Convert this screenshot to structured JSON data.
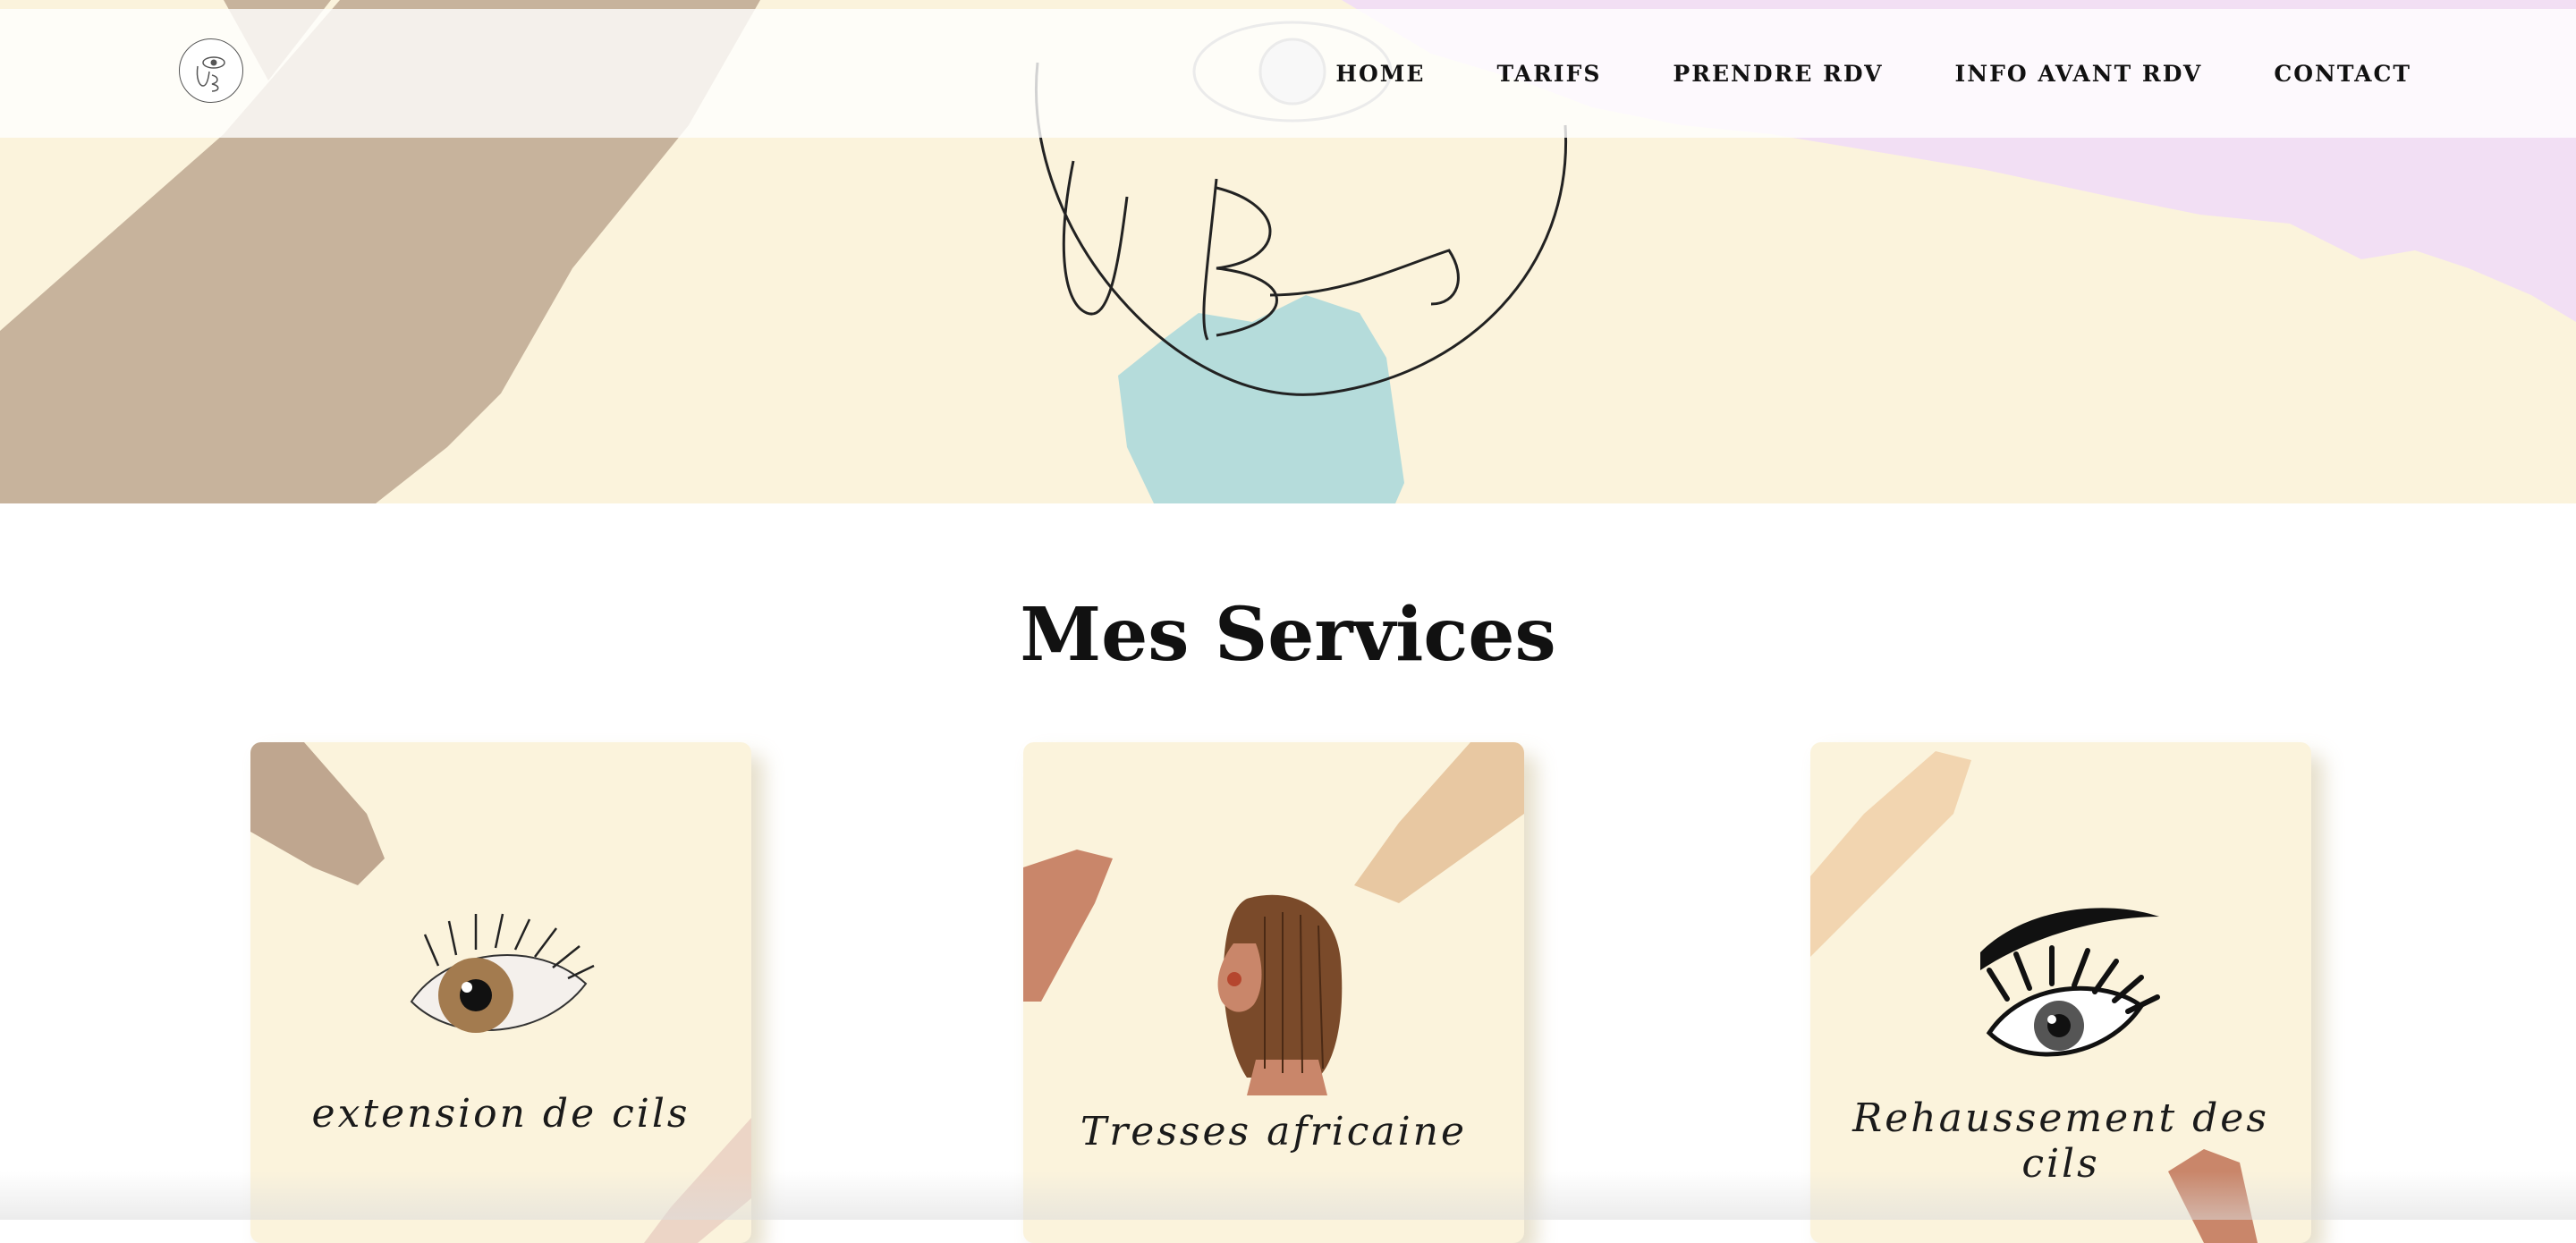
{
  "brand": {
    "logo_icon": "u-beauty-eye-logo",
    "colors": {
      "cream": "#fbf3dc",
      "taupe": "#c7b39c",
      "lilac": "#f2dff4",
      "aqua": "#b5dcdb",
      "peach": "#e8c8a2",
      "terracotta": "#c9866a"
    }
  },
  "nav": {
    "items": [
      "HOME",
      "TARIFS",
      "PRENDRE RDV",
      "INFO AVANT RDV",
      "CONTACT"
    ]
  },
  "services": {
    "title": "Mes Services",
    "cards": [
      {
        "label": "extension de cils",
        "icon": "eye-lash-extension-icon"
      },
      {
        "label": "Tresses africaine",
        "icon": "braided-hair-woman-icon"
      },
      {
        "label": "Rehaussement des cils",
        "icon": "lash-lift-eye-icon"
      }
    ]
  }
}
